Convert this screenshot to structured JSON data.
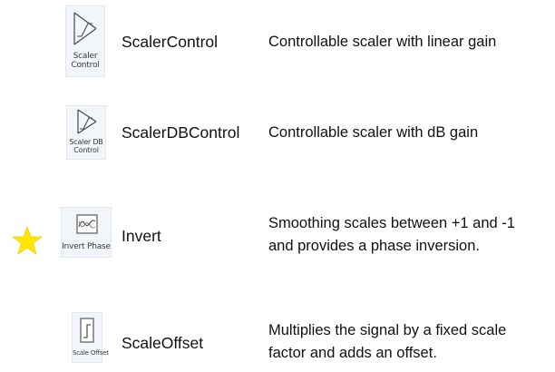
{
  "accent_color": "#ffe600",
  "modules": [
    {
      "icon": "scaler-control-icon",
      "icon_label_lines": [
        "Scaler",
        "Control"
      ],
      "name": "ScalerControl",
      "description_lines": [
        "Controllable scaler with linear gain"
      ]
    },
    {
      "icon": "scaler-db-control-icon",
      "icon_label_lines": [
        "Scaler DB",
        "Control"
      ],
      "name": "ScalerDBControl",
      "description_lines": [
        "Controllable scaler with dB gain"
      ]
    },
    {
      "icon": "invert-phase-icon",
      "icon_label_lines": [
        "Invert Phase"
      ],
      "name": "Invert",
      "description_lines": [
        "Smoothing scales between +1 and -1",
        "and provides a phase inversion."
      ],
      "marker": "star-icon"
    },
    {
      "icon": "scale-offset-icon",
      "icon_label_lines": [
        "Scale Offset"
      ],
      "name": "ScaleOffset",
      "description_lines": [
        "Multiplies the signal by a fixed scale",
        "factor and adds an offset."
      ]
    }
  ]
}
